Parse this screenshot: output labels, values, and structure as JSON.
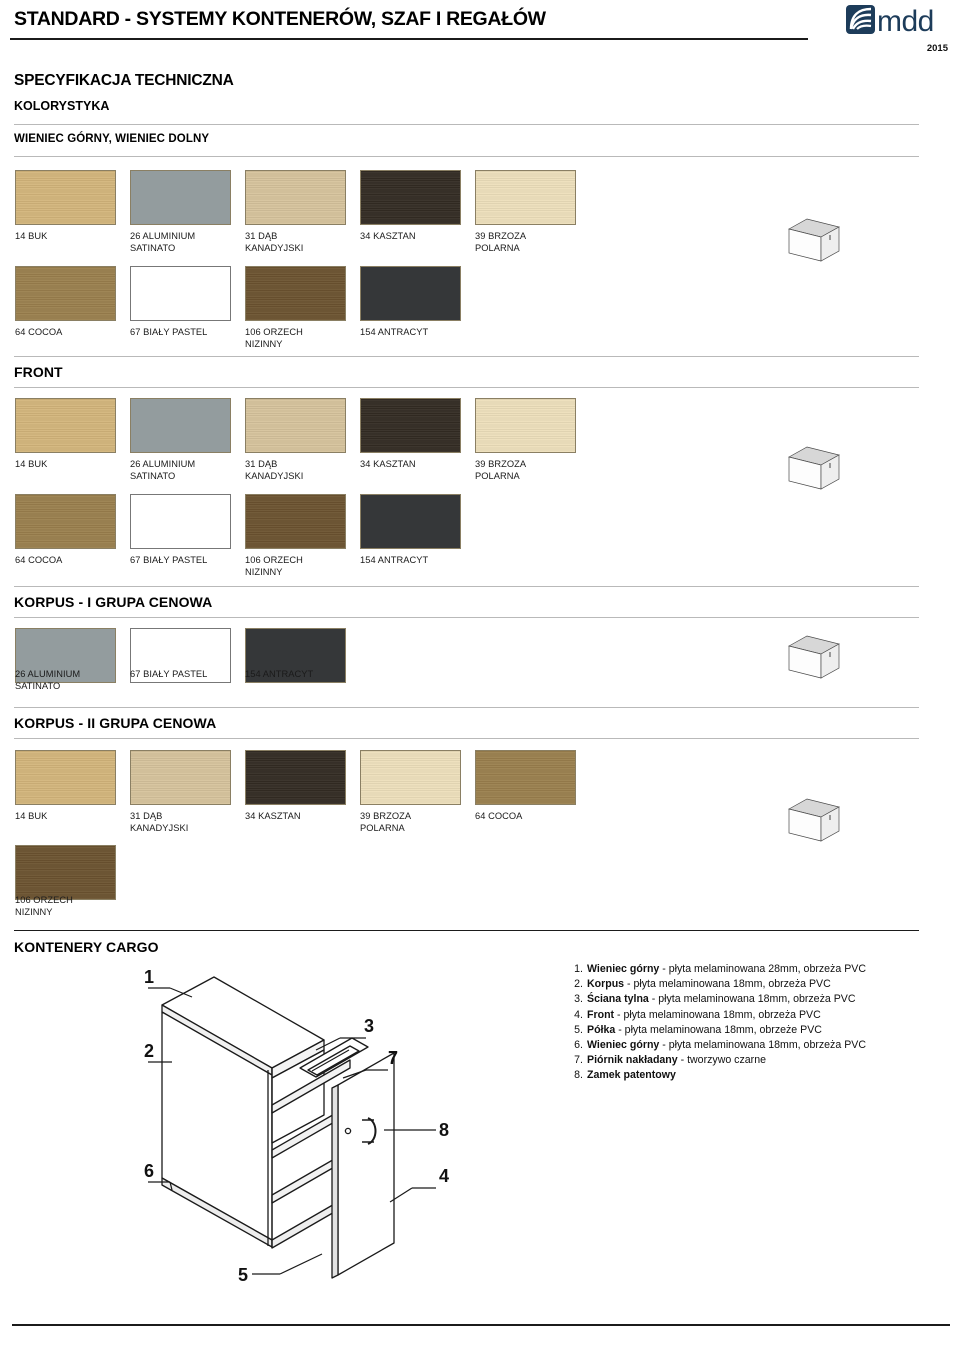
{
  "header": {
    "title": "STANDARD - SYSTEMY KONTENERÓW, SZAF I REGAŁÓW",
    "logo_text": "mdd",
    "year": "2015"
  },
  "spec": {
    "title": "SPECYFIKACJA TECHNICZNA",
    "subtitle": "KOLORYSTYKA"
  },
  "colors": {
    "buk": "#d3b57b",
    "aluminium": "#939c9e",
    "dab": "#d6c39c",
    "kasztan": "#332b23",
    "brzoza": "#eddfbb",
    "cocoa": "#9a7f4d",
    "bialy": "#ffffff",
    "orzech": "#6c5330",
    "antracyt": "#353739",
    "border": "#8a7f63",
    "logo": "#1d3c5a"
  },
  "sections": [
    {
      "heading": "WIENIEC GÓRNY, WIENIEC DOLNY",
      "swatches": [
        {
          "label": "14 BUK",
          "color": "#d3b57b",
          "grain": true
        },
        {
          "label": "26 ALUMINIUM\nSATINATO",
          "color": "#939c9e",
          "grain": false
        },
        {
          "label": "31 DĄB\nKANADYJSKI",
          "color": "#d6c39c",
          "grain": true
        },
        {
          "label": "34 KASZTAN",
          "color": "#332b23",
          "grain": true
        },
        {
          "label": "39 BRZOZA\nPOLARNA",
          "color": "#eddfbb",
          "grain": true
        },
        {
          "label": "64 COCOA",
          "color": "#9a7f4d",
          "grain": true
        },
        {
          "label": "67 BIAŁY PASTEL",
          "color": "#ffffff",
          "grain": false
        },
        {
          "label": "106 ORZECH\nNIZINNY",
          "color": "#6c5330",
          "grain": true
        },
        {
          "label": "154 ANTRACYT",
          "color": "#353739",
          "grain": false
        }
      ]
    },
    {
      "heading": "FRONT",
      "swatches": [
        {
          "label": "14 BUK",
          "color": "#d3b57b",
          "grain": true
        },
        {
          "label": "26 ALUMINIUM\nSATINATO",
          "color": "#939c9e",
          "grain": false
        },
        {
          "label": "31 DĄB\nKANADYJSKI",
          "color": "#d6c39c",
          "grain": true
        },
        {
          "label": "34 KASZTAN",
          "color": "#332b23",
          "grain": true
        },
        {
          "label": "39 BRZOZA\nPOLARNA",
          "color": "#eddfbb",
          "grain": true
        },
        {
          "label": "64 COCOA",
          "color": "#9a7f4d",
          "grain": true
        },
        {
          "label": "67 BIAŁY PASTEL",
          "color": "#ffffff",
          "grain": false
        },
        {
          "label": "106 ORZECH\nNIZINNY",
          "color": "#6c5330",
          "grain": true
        },
        {
          "label": "154 ANTRACYT",
          "color": "#353739",
          "grain": false
        }
      ]
    },
    {
      "heading": "KORPUS - I GRUPA CENOWA",
      "swatches": [
        {
          "label": "26 ALUMINIUM\nSATINATO",
          "color": "#939c9e",
          "grain": false
        },
        {
          "label": "67 BIAŁY PASTEL",
          "color": "#ffffff",
          "grain": false
        },
        {
          "label": "154 ANTRACYT",
          "color": "#353739",
          "grain": false
        }
      ]
    },
    {
      "heading": "KORPUS - II GRUPA CENOWA",
      "swatches": [
        {
          "label": "14 BUK",
          "color": "#d3b57b",
          "grain": true
        },
        {
          "label": "31 DĄB\nKANADYJSKI",
          "color": "#d6c39c",
          "grain": true
        },
        {
          "label": "34 KASZTAN",
          "color": "#332b23",
          "grain": true
        },
        {
          "label": "39 BRZOZA\nPOLARNA",
          "color": "#eddfbb",
          "grain": true
        },
        {
          "label": "64 COCOA",
          "color": "#9a7f4d",
          "grain": true
        },
        {
          "label": "106 ORZECH\nNIZINNY",
          "color": "#6c5330",
          "grain": true
        }
      ]
    }
  ],
  "cargo": {
    "heading": "KONTENERY CARGO",
    "callouts": [
      "1",
      "2",
      "3",
      "4",
      "5",
      "6",
      "7",
      "8"
    ],
    "items": [
      {
        "num": "1.",
        "strong": "Wieniec górny",
        "rest": " - płyta melaminowana 28mm, obrzeża PVC"
      },
      {
        "num": "2.",
        "strong": "Korpus",
        "rest": " - płyta melaminowana 18mm, obrzeża PVC"
      },
      {
        "num": "3.",
        "strong": "Ściana tylna",
        "rest": " - płyta melaminowana 18mm, obrzeża PVC"
      },
      {
        "num": "4.",
        "strong": "Front",
        "rest": " - płyta melaminowana 18mm, obrzeża PVC"
      },
      {
        "num": "5.",
        "strong": "Półka",
        "rest": " - płyta melaminowana 18mm, obrzeże PVC"
      },
      {
        "num": "6.",
        "strong": "Wieniec górny",
        "rest": " - płyta melaminowana 18mm, obrzeża PVC"
      },
      {
        "num": "7.",
        "strong": "Piórnik nakładany",
        "rest": " - tworzywo czarne"
      },
      {
        "num": "8.",
        "strong": "Zamek patentowy",
        "rest": ""
      }
    ]
  }
}
